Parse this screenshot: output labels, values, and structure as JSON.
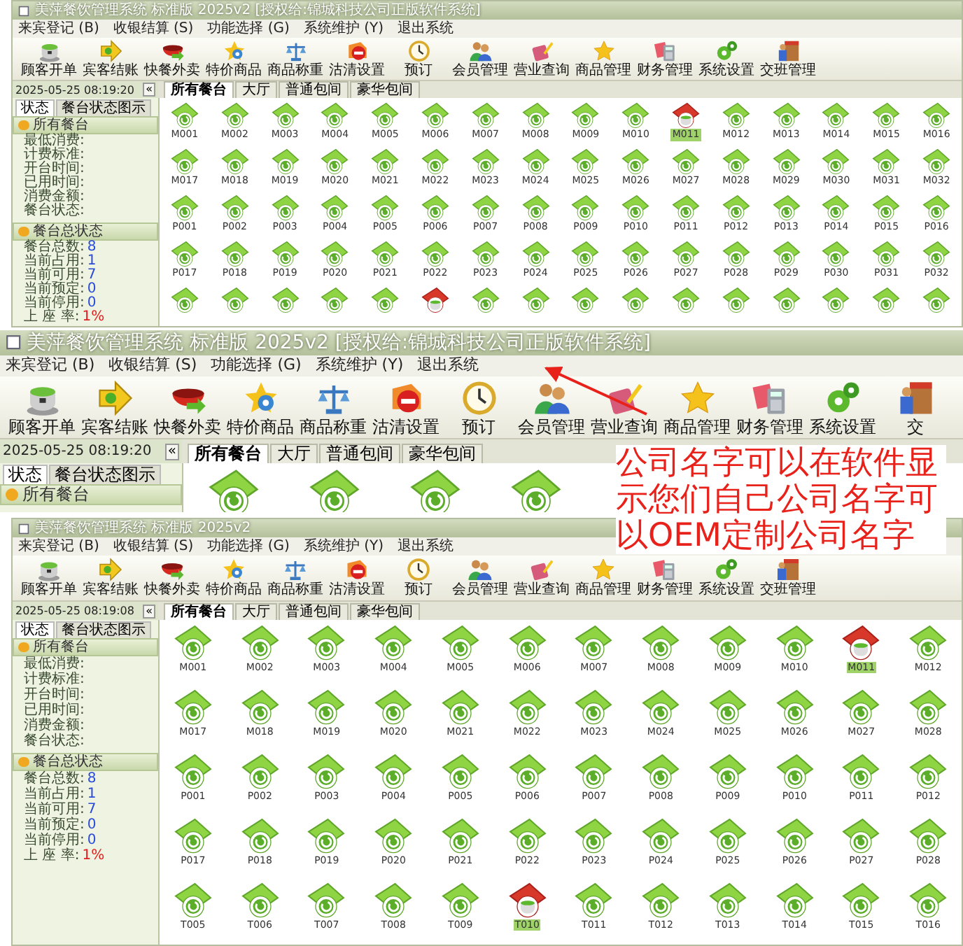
{
  "screens": [
    {
      "title": "美萍餐饮管理系统 标准版 2025v2 [授权给:锦城科技公司正版软件系统]",
      "menu": [
        "来宾登记 (B)",
        "收银结算 (S)",
        "功能选择 (G)",
        "系统维护 (Y)",
        "退出系统"
      ],
      "toolbar": [
        "顾客开单",
        "宾客结账",
        "快餐外卖",
        "特价商品",
        "商品称重",
        "沽清设置",
        "预订",
        "会员管理",
        "营业查询",
        "商品管理",
        "财务管理",
        "系统设置",
        "交班管理"
      ],
      "clock": "2025-05-25 08:19:20",
      "collapse": "«",
      "tabs": [
        {
          "label": "所有餐台",
          "selected": true
        },
        {
          "label": "大厅",
          "selected": false
        },
        {
          "label": "普通包间",
          "selected": false
        },
        {
          "label": "豪华包间",
          "selected": false
        }
      ],
      "side_tabs": [
        {
          "label": "状态",
          "selected": true
        },
        {
          "label": "餐台状态图示",
          "selected": false
        }
      ],
      "panels": [
        {
          "title": "所有餐台",
          "fields": [
            {
              "label": "最低消费:"
            },
            {
              "label": "计费标准:"
            },
            {
              "label": "开台时间:"
            },
            {
              "label": "已用时间:"
            },
            {
              "label": "消费金额:"
            },
            {
              "label": "餐台状态:"
            }
          ]
        },
        {
          "title": "餐台总状态",
          "fields": [
            {
              "label": "餐台总数:",
              "value": "8",
              "kind": "count"
            },
            {
              "label": "当前占用:",
              "value": "1",
              "kind": "count"
            },
            {
              "label": "当前可用:",
              "value": "7",
              "kind": "count"
            },
            {
              "label": "当前预定:",
              "value": "0",
              "kind": "count"
            },
            {
              "label": "当前停用:",
              "value": "0",
              "kind": "count"
            },
            {
              "label": "上 座 率:",
              "value": "1%",
              "kind": "percent"
            }
          ]
        }
      ],
      "table_rows": [
        {
          "tables": [
            {
              "label": "M001",
              "occupied": false
            },
            {
              "label": "M002",
              "occupied": false
            },
            {
              "label": "M003",
              "occupied": false
            },
            {
              "label": "M004",
              "occupied": false
            },
            {
              "label": "M005",
              "occupied": false
            },
            {
              "label": "M006",
              "occupied": false
            },
            {
              "label": "M007",
              "occupied": false
            },
            {
              "label": "M008",
              "occupied": false
            },
            {
              "label": "M009",
              "occupied": false
            },
            {
              "label": "M010",
              "occupied": false
            },
            {
              "label": "M011",
              "occupied": true
            },
            {
              "label": "M012",
              "occupied": false
            },
            {
              "label": "M013",
              "occupied": false
            },
            {
              "label": "M014",
              "occupied": false
            },
            {
              "label": "M015",
              "occupied": false
            },
            {
              "label": "M016",
              "occupied": false
            }
          ]
        },
        {
          "tables": [
            {
              "label": "M017",
              "occupied": false
            },
            {
              "label": "M018",
              "occupied": false
            },
            {
              "label": "M019",
              "occupied": false
            },
            {
              "label": "M020",
              "occupied": false
            },
            {
              "label": "M021",
              "occupied": false
            },
            {
              "label": "M022",
              "occupied": false
            },
            {
              "label": "M023",
              "occupied": false
            },
            {
              "label": "M024",
              "occupied": false
            },
            {
              "label": "M025",
              "occupied": false
            },
            {
              "label": "M026",
              "occupied": false
            },
            {
              "label": "M027",
              "occupied": false
            },
            {
              "label": "M028",
              "occupied": false
            },
            {
              "label": "M029",
              "occupied": false
            },
            {
              "label": "M030",
              "occupied": false
            },
            {
              "label": "M031",
              "occupied": false
            },
            {
              "label": "M032",
              "occupied": false
            }
          ]
        },
        {
          "tables": [
            {
              "label": "P001",
              "occupied": false
            },
            {
              "label": "P002",
              "occupied": false
            },
            {
              "label": "P003",
              "occupied": false
            },
            {
              "label": "P004",
              "occupied": false
            },
            {
              "label": "P005",
              "occupied": false
            },
            {
              "label": "P006",
              "occupied": false
            },
            {
              "label": "P007",
              "occupied": false
            },
            {
              "label": "P008",
              "occupied": false
            },
            {
              "label": "P009",
              "occupied": false
            },
            {
              "label": "P010",
              "occupied": false
            },
            {
              "label": "P011",
              "occupied": false
            },
            {
              "label": "P012",
              "occupied": false
            },
            {
              "label": "P013",
              "occupied": false
            },
            {
              "label": "P014",
              "occupied": false
            },
            {
              "label": "P015",
              "occupied": false
            },
            {
              "label": "P016",
              "occupied": false
            }
          ]
        },
        {
          "tables": [
            {
              "label": "P017",
              "occupied": false
            },
            {
              "label": "P018",
              "occupied": false
            },
            {
              "label": "P019",
              "occupied": false
            },
            {
              "label": "P020",
              "occupied": false
            },
            {
              "label": "P021",
              "occupied": false
            },
            {
              "label": "P022",
              "occupied": false
            },
            {
              "label": "P023",
              "occupied": false
            },
            {
              "label": "P024",
              "occupied": false
            },
            {
              "label": "P025",
              "occupied": false
            },
            {
              "label": "P026",
              "occupied": false
            },
            {
              "label": "P027",
              "occupied": false
            },
            {
              "label": "P028",
              "occupied": false
            },
            {
              "label": "P029",
              "occupied": false
            },
            {
              "label": "P030",
              "occupied": false
            },
            {
              "label": "P031",
              "occupied": false
            },
            {
              "label": "P032",
              "occupied": false
            }
          ]
        },
        {
          "tables": [
            {
              "occupied": false
            },
            {
              "occupied": false
            },
            {
              "occupied": false
            },
            {
              "occupied": false
            },
            {
              "occupied": false
            },
            {
              "occupied": true
            },
            {
              "occupied": false
            },
            {
              "occupied": false
            },
            {
              "occupied": false
            },
            {
              "occupied": false
            },
            {
              "occupied": false
            },
            {
              "occupied": false
            },
            {
              "occupied": false
            },
            {
              "occupied": false
            },
            {
              "occupied": false
            },
            {
              "occupied": false
            }
          ]
        }
      ]
    },
    {
      "title": "美萍餐饮管理系统 标准版 2025v2 [授权给:锦城科技公司正版软件系统]",
      "menu": [
        "来宾登记 (B)",
        "收银结算 (S)",
        "功能选择 (G)",
        "系统维护 (Y)",
        "退出系统"
      ],
      "toolbar": [
        "顾客开单",
        "宾客结账",
        "快餐外卖",
        "特价商品",
        "商品称重",
        "沽清设置",
        "预订",
        "会员管理",
        "营业查询",
        "商品管理",
        "财务管理",
        "系统设置",
        "交"
      ],
      "clock": "2025-05-25 08:19:20",
      "collapse": "«",
      "tabs": [
        {
          "label": "所有餐台",
          "selected": true
        },
        {
          "label": "大厅",
          "selected": false
        },
        {
          "label": "普通包间",
          "selected": false
        },
        {
          "label": "豪华包间",
          "selected": false
        }
      ],
      "side_tabs": [
        {
          "label": "状态",
          "selected": true
        },
        {
          "label": "餐台状态图示",
          "selected": false
        }
      ],
      "panels": [
        {
          "title": "所有餐台"
        }
      ],
      "table_rows": [
        {
          "tables": [
            {
              "occupied": false
            },
            {
              "occupied": false
            },
            {
              "occupied": false
            },
            {
              "occupied": false
            }
          ]
        }
      ]
    },
    {
      "title": "美萍餐饮管理系统 标准版 2025v2",
      "menu": [
        "来宾登记 (B)",
        "收银结算 (S)",
        "功能选择 (G)",
        "系统维护 (Y)",
        "退出系统"
      ],
      "toolbar": [
        "顾客开单",
        "宾客结账",
        "快餐外卖",
        "特价商品",
        "商品称重",
        "沽清设置",
        "预订",
        "会员管理",
        "营业查询",
        "商品管理",
        "财务管理",
        "系统设置",
        "交班管理"
      ],
      "clock": "2025-05-25 08:19:08",
      "collapse": "«",
      "tabs": [
        {
          "label": "所有餐台",
          "selected": true
        },
        {
          "label": "大厅",
          "selected": false
        },
        {
          "label": "普通包间",
          "selected": false
        },
        {
          "label": "豪华包间",
          "selected": false
        }
      ],
      "side_tabs": [
        {
          "label": "状态",
          "selected": true
        },
        {
          "label": "餐台状态图示",
          "selected": false
        }
      ],
      "panels": [
        {
          "title": "所有餐台",
          "fields": [
            {
              "label": "最低消费:"
            },
            {
              "label": "计费标准:"
            },
            {
              "label": "开台时间:"
            },
            {
              "label": "已用时间:"
            },
            {
              "label": "消费金额:"
            },
            {
              "label": "餐台状态:"
            }
          ]
        },
        {
          "title": "餐台总状态",
          "fields": [
            {
              "label": "餐台总数:",
              "value": "8",
              "kind": "count"
            },
            {
              "label": "当前占用:",
              "value": "1",
              "kind": "count"
            },
            {
              "label": "当前可用:",
              "value": "7",
              "kind": "count"
            },
            {
              "label": "当前预定:",
              "value": "0",
              "kind": "count"
            },
            {
              "label": "当前停用:",
              "value": "0",
              "kind": "count"
            },
            {
              "label": "上 座 率:",
              "value": "1%",
              "kind": "percent"
            }
          ]
        }
      ],
      "table_rows": [
        {
          "tables": [
            {
              "label": "M001",
              "occupied": false
            },
            {
              "label": "M002",
              "occupied": false
            },
            {
              "label": "M003",
              "occupied": false
            },
            {
              "label": "M004",
              "occupied": false
            },
            {
              "label": "M005",
              "occupied": false
            },
            {
              "label": "M006",
              "occupied": false
            },
            {
              "label": "M007",
              "occupied": false
            },
            {
              "label": "M008",
              "occupied": false
            },
            {
              "label": "M009",
              "occupied": false
            },
            {
              "label": "M010",
              "occupied": false
            },
            {
              "label": "M011",
              "occupied": true
            },
            {
              "label": "M012",
              "occupied": false
            }
          ]
        },
        {
          "tables": [
            {
              "label": "M017",
              "occupied": false
            },
            {
              "label": "M018",
              "occupied": false
            },
            {
              "label": "M019",
              "occupied": false
            },
            {
              "label": "M020",
              "occupied": false
            },
            {
              "label": "M021",
              "occupied": false
            },
            {
              "label": "M022",
              "occupied": false
            },
            {
              "label": "M023",
              "occupied": false
            },
            {
              "label": "M024",
              "occupied": false
            },
            {
              "label": "M025",
              "occupied": false
            },
            {
              "label": "M026",
              "occupied": false
            },
            {
              "label": "M027",
              "occupied": false
            },
            {
              "label": "M028",
              "occupied": false
            }
          ]
        },
        {
          "tables": [
            {
              "label": "P001",
              "occupied": false
            },
            {
              "label": "P002",
              "occupied": false
            },
            {
              "label": "P003",
              "occupied": false
            },
            {
              "label": "P004",
              "occupied": false
            },
            {
              "label": "P005",
              "occupied": false
            },
            {
              "label": "P006",
              "occupied": false
            },
            {
              "label": "P007",
              "occupied": false
            },
            {
              "label": "P008",
              "occupied": false
            },
            {
              "label": "P009",
              "occupied": false
            },
            {
              "label": "P010",
              "occupied": false
            },
            {
              "label": "P011",
              "occupied": false
            },
            {
              "label": "P012",
              "occupied": false
            }
          ]
        },
        {
          "tables": [
            {
              "label": "P017",
              "occupied": false
            },
            {
              "label": "P018",
              "occupied": false
            },
            {
              "label": "P019",
              "occupied": false
            },
            {
              "label": "P020",
              "occupied": false
            },
            {
              "label": "P021",
              "occupied": false
            },
            {
              "label": "P022",
              "occupied": false
            },
            {
              "label": "P023",
              "occupied": false
            },
            {
              "label": "P024",
              "occupied": false
            },
            {
              "label": "P025",
              "occupied": false
            },
            {
              "label": "P026",
              "occupied": false
            },
            {
              "label": "P027",
              "occupied": false
            },
            {
              "label": "P028",
              "occupied": false
            }
          ]
        },
        {
          "tables": [
            {
              "label": "T005",
              "occupied": false
            },
            {
              "label": "T006",
              "occupied": false
            },
            {
              "label": "T007",
              "occupied": false
            },
            {
              "label": "T008",
              "occupied": false
            },
            {
              "label": "T009",
              "occupied": false
            },
            {
              "label": "T010",
              "occupied": true
            },
            {
              "label": "T011",
              "occupied": false
            },
            {
              "label": "T012",
              "occupied": false
            },
            {
              "label": "T013",
              "occupied": false
            },
            {
              "label": "T014",
              "occupied": false
            },
            {
              "label": "T015",
              "occupied": false
            },
            {
              "label": "T016",
              "occupied": false
            }
          ]
        }
      ]
    }
  ],
  "annotation": {
    "text": "公司名字可以在软件显示您们自己公司名字可以OEM定制公司名字"
  }
}
